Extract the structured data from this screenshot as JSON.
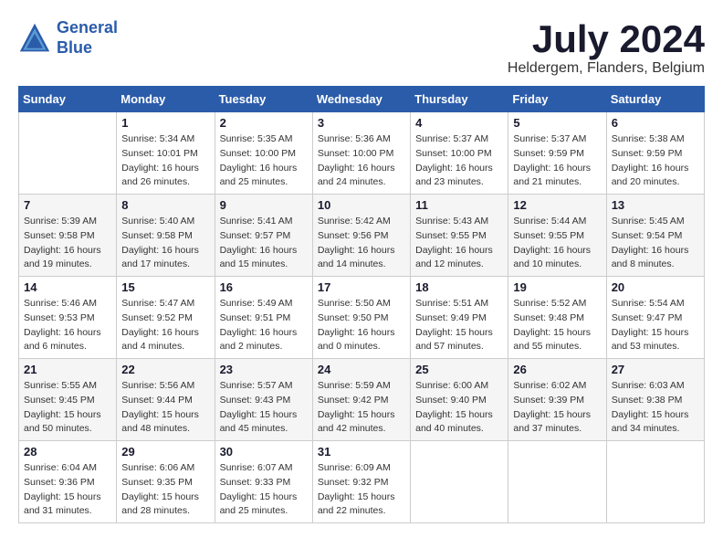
{
  "header": {
    "logo_line1": "General",
    "logo_line2": "Blue",
    "month": "July 2024",
    "location": "Heldergem, Flanders, Belgium"
  },
  "weekdays": [
    "Sunday",
    "Monday",
    "Tuesday",
    "Wednesday",
    "Thursday",
    "Friday",
    "Saturday"
  ],
  "weeks": [
    [
      {
        "day": "",
        "info": ""
      },
      {
        "day": "1",
        "info": "Sunrise: 5:34 AM\nSunset: 10:01 PM\nDaylight: 16 hours\nand 26 minutes."
      },
      {
        "day": "2",
        "info": "Sunrise: 5:35 AM\nSunset: 10:00 PM\nDaylight: 16 hours\nand 25 minutes."
      },
      {
        "day": "3",
        "info": "Sunrise: 5:36 AM\nSunset: 10:00 PM\nDaylight: 16 hours\nand 24 minutes."
      },
      {
        "day": "4",
        "info": "Sunrise: 5:37 AM\nSunset: 10:00 PM\nDaylight: 16 hours\nand 23 minutes."
      },
      {
        "day": "5",
        "info": "Sunrise: 5:37 AM\nSunset: 9:59 PM\nDaylight: 16 hours\nand 21 minutes."
      },
      {
        "day": "6",
        "info": "Sunrise: 5:38 AM\nSunset: 9:59 PM\nDaylight: 16 hours\nand 20 minutes."
      }
    ],
    [
      {
        "day": "7",
        "info": "Sunrise: 5:39 AM\nSunset: 9:58 PM\nDaylight: 16 hours\nand 19 minutes."
      },
      {
        "day": "8",
        "info": "Sunrise: 5:40 AM\nSunset: 9:58 PM\nDaylight: 16 hours\nand 17 minutes."
      },
      {
        "day": "9",
        "info": "Sunrise: 5:41 AM\nSunset: 9:57 PM\nDaylight: 16 hours\nand 15 minutes."
      },
      {
        "day": "10",
        "info": "Sunrise: 5:42 AM\nSunset: 9:56 PM\nDaylight: 16 hours\nand 14 minutes."
      },
      {
        "day": "11",
        "info": "Sunrise: 5:43 AM\nSunset: 9:55 PM\nDaylight: 16 hours\nand 12 minutes."
      },
      {
        "day": "12",
        "info": "Sunrise: 5:44 AM\nSunset: 9:55 PM\nDaylight: 16 hours\nand 10 minutes."
      },
      {
        "day": "13",
        "info": "Sunrise: 5:45 AM\nSunset: 9:54 PM\nDaylight: 16 hours\nand 8 minutes."
      }
    ],
    [
      {
        "day": "14",
        "info": "Sunrise: 5:46 AM\nSunset: 9:53 PM\nDaylight: 16 hours\nand 6 minutes."
      },
      {
        "day": "15",
        "info": "Sunrise: 5:47 AM\nSunset: 9:52 PM\nDaylight: 16 hours\nand 4 minutes."
      },
      {
        "day": "16",
        "info": "Sunrise: 5:49 AM\nSunset: 9:51 PM\nDaylight: 16 hours\nand 2 minutes."
      },
      {
        "day": "17",
        "info": "Sunrise: 5:50 AM\nSunset: 9:50 PM\nDaylight: 16 hours\nand 0 minutes."
      },
      {
        "day": "18",
        "info": "Sunrise: 5:51 AM\nSunset: 9:49 PM\nDaylight: 15 hours\nand 57 minutes."
      },
      {
        "day": "19",
        "info": "Sunrise: 5:52 AM\nSunset: 9:48 PM\nDaylight: 15 hours\nand 55 minutes."
      },
      {
        "day": "20",
        "info": "Sunrise: 5:54 AM\nSunset: 9:47 PM\nDaylight: 15 hours\nand 53 minutes."
      }
    ],
    [
      {
        "day": "21",
        "info": "Sunrise: 5:55 AM\nSunset: 9:45 PM\nDaylight: 15 hours\nand 50 minutes."
      },
      {
        "day": "22",
        "info": "Sunrise: 5:56 AM\nSunset: 9:44 PM\nDaylight: 15 hours\nand 48 minutes."
      },
      {
        "day": "23",
        "info": "Sunrise: 5:57 AM\nSunset: 9:43 PM\nDaylight: 15 hours\nand 45 minutes."
      },
      {
        "day": "24",
        "info": "Sunrise: 5:59 AM\nSunset: 9:42 PM\nDaylight: 15 hours\nand 42 minutes."
      },
      {
        "day": "25",
        "info": "Sunrise: 6:00 AM\nSunset: 9:40 PM\nDaylight: 15 hours\nand 40 minutes."
      },
      {
        "day": "26",
        "info": "Sunrise: 6:02 AM\nSunset: 9:39 PM\nDaylight: 15 hours\nand 37 minutes."
      },
      {
        "day": "27",
        "info": "Sunrise: 6:03 AM\nSunset: 9:38 PM\nDaylight: 15 hours\nand 34 minutes."
      }
    ],
    [
      {
        "day": "28",
        "info": "Sunrise: 6:04 AM\nSunset: 9:36 PM\nDaylight: 15 hours\nand 31 minutes."
      },
      {
        "day": "29",
        "info": "Sunrise: 6:06 AM\nSunset: 9:35 PM\nDaylight: 15 hours\nand 28 minutes."
      },
      {
        "day": "30",
        "info": "Sunrise: 6:07 AM\nSunset: 9:33 PM\nDaylight: 15 hours\nand 25 minutes."
      },
      {
        "day": "31",
        "info": "Sunrise: 6:09 AM\nSunset: 9:32 PM\nDaylight: 15 hours\nand 22 minutes."
      },
      {
        "day": "",
        "info": ""
      },
      {
        "day": "",
        "info": ""
      },
      {
        "day": "",
        "info": ""
      }
    ]
  ]
}
